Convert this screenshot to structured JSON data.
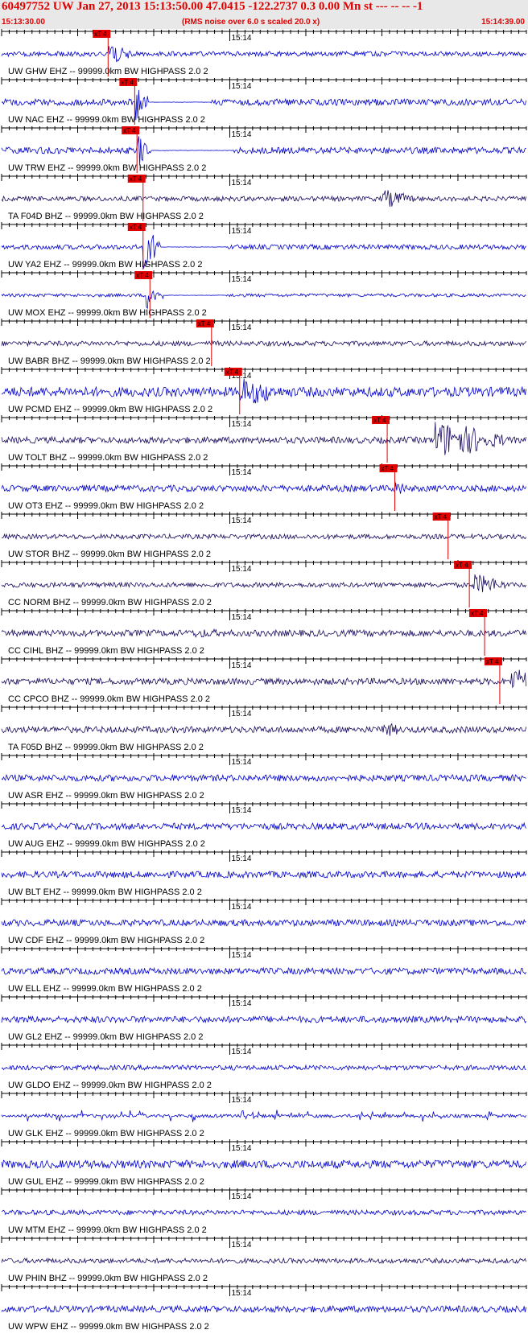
{
  "header": {
    "title": "60497752 UW Jan 27, 2013 15:13:50.00   47.0415 -122.2737  0.3 0.00 Mn st --- -- --  -1",
    "start_time": "15:13:30.00",
    "note": "(RMS noise over 6.0 s scaled 20.0 x)",
    "end_time": "15:14:39.00"
  },
  "colors": {
    "header_text": "#e00000",
    "trace_blue": "#0000cc",
    "trace_navy": "#1a0a5e",
    "pick": "#e00000",
    "axis": "#000000"
  },
  "chart_data": {
    "type": "line",
    "x_range_seconds": [
      0,
      69
    ],
    "start_time": "15:13:30.00",
    "end_time": "15:14:39.00",
    "minute_mark_label": "15:14",
    "minute_mark_seconds": 30,
    "pick_label": "xT 4",
    "traces": [
      {
        "label": "UW GHW EHZ -- 99999.0km BW  HIGHPASS  2.0  2",
        "color": "blue",
        "pick_s": 14.0,
        "amp": 3,
        "event": [
          14.0,
          2.0,
          16
        ]
      },
      {
        "label": "UW NAC EHZ -- 99999.0km BW  HIGHPASS  2.0  2",
        "color": "blue",
        "pick_s": 17.5,
        "amp": 4,
        "event": [
          17.5,
          1.2,
          24
        ],
        "flat": [
          18.5,
          27.5
        ]
      },
      {
        "label": "UW TRW EHZ -- 99999.0km BW  HIGHPASS  2.0  2",
        "color": "blue",
        "pick_s": 17.8,
        "amp": 4,
        "event": [
          17.8,
          1.2,
          24
        ],
        "flat": [
          18.8,
          30.5
        ]
      },
      {
        "label": "TA F04D BHZ -- 99999.0km BW  HIGHPASS  2.0  2",
        "color": "navy",
        "pick_s": 18.6,
        "amp": 3,
        "event": [
          50.0,
          3.0,
          12
        ]
      },
      {
        "label": "UW YA2 EHZ -- 99999.0km BW  HIGHPASS  2.0  2",
        "color": "blue",
        "pick_s": 18.6,
        "amp": 3,
        "event": [
          18.6,
          1.5,
          28
        ],
        "flat": [
          19.5,
          29.5
        ]
      },
      {
        "label": "UW MOX EHZ -- 99999.0km BW  HIGHPASS  2.0  2",
        "color": "blue",
        "pick_s": 19.5,
        "amp": 2,
        "event": [
          19.0,
          1.5,
          18
        ],
        "flat": [
          20.0,
          29.5
        ]
      },
      {
        "label": "UW BABR BHZ -- 99999.0km BW  HIGHPASS  2.0  2",
        "color": "navy",
        "pick_s": 27.6,
        "amp": 3,
        "event": [
          27.6,
          2.0,
          4
        ]
      },
      {
        "label": "UW PCMD EHZ -- 99999.0km BW  HIGHPASS  2.0  2",
        "color": "blue",
        "pick_s": 31.3,
        "amp": 6,
        "event": [
          31.3,
          4.5,
          18
        ]
      },
      {
        "label": "UW TOLT BHZ -- 99999.0km BW  HIGHPASS  2.0  2",
        "color": "navy",
        "pick_s": 50.7,
        "amp": 4,
        "event": [
          57.0,
          6.0,
          24
        ]
      },
      {
        "label": "UW OT3 EHZ -- 99999.0km BW  HIGHPASS  2.0  2",
        "color": "blue",
        "pick_s": 51.7,
        "amp": 4,
        "event": [
          51.7,
          1.2,
          12
        ]
      },
      {
        "label": "UW STOR BHZ -- 99999.0km BW  HIGHPASS  2.0  2",
        "color": "navy",
        "pick_s": 58.7,
        "amp": 3,
        "event": [
          58.7,
          2.0,
          3
        ]
      },
      {
        "label": "CC NORM BHZ -- 99999.0km BW  HIGHPASS  2.0  2",
        "color": "navy",
        "pick_s": 61.5,
        "amp": 3,
        "event": [
          62.0,
          3.0,
          14
        ]
      },
      {
        "label": "CC CIHL BHZ -- 99999.0km BW  HIGHPASS  2.0  2",
        "color": "navy",
        "pick_s": 63.5,
        "amp": 4,
        "event": [
          25.5,
          5.0,
          6
        ]
      },
      {
        "label": "CC CPCO BHZ -- 99999.0km BW  HIGHPASS  2.0  2",
        "color": "navy",
        "pick_s": 65.5,
        "amp": 4,
        "event": [
          67.0,
          2.5,
          18
        ]
      },
      {
        "label": "TA F05D BHZ -- 99999.0km BW  HIGHPASS  2.0  2",
        "color": "navy",
        "pick_s": null,
        "amp": 4,
        "event": [
          50.0,
          2.0,
          10
        ]
      },
      {
        "label": "UW ASR EHZ -- 99999.0km BW  HIGHPASS  2.0  2",
        "color": "blue",
        "pick_s": null,
        "amp": 4
      },
      {
        "label": "UW AUG EHZ -- 99999.0km BW  HIGHPASS  2.0  2",
        "color": "blue",
        "pick_s": null,
        "amp": 4
      },
      {
        "label": "UW BLT EHZ -- 99999.0km BW  HIGHPASS  2.0  2",
        "color": "blue",
        "pick_s": null,
        "amp": 4
      },
      {
        "label": "UW CDF EHZ -- 99999.0km BW  HIGHPASS  2.0  2",
        "color": "blue",
        "pick_s": null,
        "amp": 4
      },
      {
        "label": "UW ELL EHZ -- 99999.0km BW  HIGHPASS  2.0  2",
        "color": "blue",
        "pick_s": null,
        "amp": 4
      },
      {
        "label": "UW GL2 EHZ -- 99999.0km BW  HIGHPASS  2.0  2",
        "color": "blue",
        "pick_s": null,
        "amp": 4
      },
      {
        "label": "UW GLDO EHZ -- 99999.0km BW  HIGHPASS  2.0  2",
        "color": "blue",
        "pick_s": null,
        "amp": 3
      },
      {
        "label": "UW GLK EHZ -- 99999.0km BW  HIGHPASS  2.0  2",
        "color": "blue",
        "pick_s": null,
        "amp": 2,
        "bursty": true
      },
      {
        "label": "UW GUL EHZ -- 99999.0km BW  HIGHPASS  2.0  2",
        "color": "blue",
        "pick_s": null,
        "amp": 5
      },
      {
        "label": "UW MTM EHZ -- 99999.0km BW  HIGHPASS  2.0  2",
        "color": "blue",
        "pick_s": null,
        "amp": 3
      },
      {
        "label": "UW PHIN BHZ -- 99999.0km BW  HIGHPASS  2.0  2",
        "color": "navy",
        "pick_s": null,
        "amp": 3
      },
      {
        "label": "UW WPW EHZ -- 99999.0km BW  HIGHPASS  2.0  2",
        "color": "blue",
        "pick_s": null,
        "amp": 4
      }
    ]
  }
}
